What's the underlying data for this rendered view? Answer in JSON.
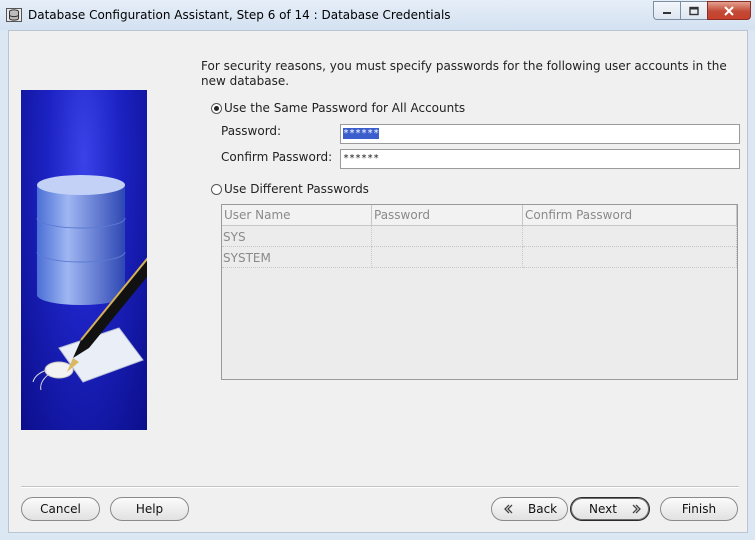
{
  "window": {
    "title": "Database Configuration Assistant, Step 6 of 14 : Database Credentials"
  },
  "intro_text": "For security reasons, you must specify passwords for the following user accounts in the new database.",
  "same_password": {
    "label": "Use the Same Password for All Accounts",
    "selected": true,
    "password_label": "Password:",
    "password_value": "******",
    "confirm_label": "Confirm Password:",
    "confirm_value": "******"
  },
  "different_passwords": {
    "label": "Use Different Passwords",
    "selected": false,
    "columns": [
      "User Name",
      "Password",
      "Confirm Password"
    ],
    "rows": [
      [
        "SYS",
        "",
        ""
      ],
      [
        "SYSTEM",
        "",
        ""
      ]
    ]
  },
  "buttons": {
    "cancel": "Cancel",
    "help": "Help",
    "back": "Back",
    "next": "Next",
    "finish": "Finish"
  }
}
